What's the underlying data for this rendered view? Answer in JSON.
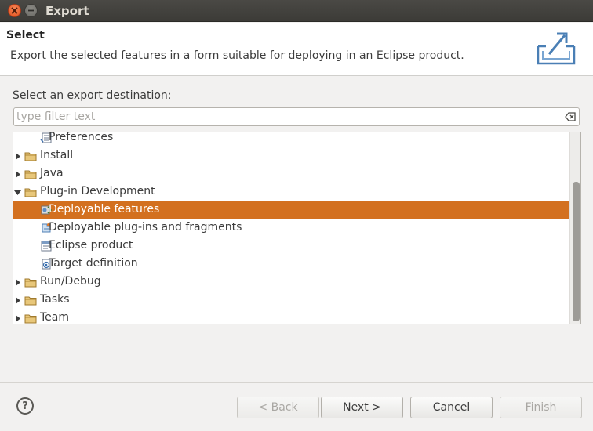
{
  "window": {
    "title": "Export"
  },
  "header": {
    "title": "Select",
    "description": "Export the selected features in a form suitable for deploying in an Eclipse product.",
    "icon": "export-icon"
  },
  "destination": {
    "label": "Select an export destination:",
    "filter_placeholder": "type filter text",
    "filter_value": ""
  },
  "tree": {
    "items": [
      {
        "label": "Preferences",
        "icon": "preferences-icon",
        "level": 1,
        "expander": "none",
        "selected": false
      },
      {
        "label": "Install",
        "icon": "folder-icon",
        "level": 0,
        "expander": "collapsed",
        "selected": false
      },
      {
        "label": "Java",
        "icon": "folder-icon",
        "level": 0,
        "expander": "collapsed",
        "selected": false
      },
      {
        "label": "Plug-in Development",
        "icon": "folder-icon",
        "level": 0,
        "expander": "expanded",
        "selected": false
      },
      {
        "label": "Deployable features",
        "icon": "feature-icon",
        "level": 1,
        "expander": "none",
        "selected": true
      },
      {
        "label": "Deployable plug-ins and fragments",
        "icon": "plugin-icon",
        "level": 1,
        "expander": "none",
        "selected": false
      },
      {
        "label": "Eclipse product",
        "icon": "product-icon",
        "level": 1,
        "expander": "none",
        "selected": false
      },
      {
        "label": "Target definition",
        "icon": "target-icon",
        "level": 1,
        "expander": "none",
        "selected": false
      },
      {
        "label": "Run/Debug",
        "icon": "folder-icon",
        "level": 0,
        "expander": "collapsed",
        "selected": false
      },
      {
        "label": "Tasks",
        "icon": "folder-icon",
        "level": 0,
        "expander": "collapsed",
        "selected": false
      },
      {
        "label": "Team",
        "icon": "folder-icon",
        "level": 0,
        "expander": "collapsed",
        "selected": false
      }
    ]
  },
  "buttons": {
    "help": "?",
    "back": "< Back",
    "next": "Next >",
    "cancel": "Cancel",
    "finish": "Finish"
  },
  "colors": {
    "selection": "#d3701f",
    "titlebar": "#3c3b37",
    "close_button": "#e95420"
  }
}
